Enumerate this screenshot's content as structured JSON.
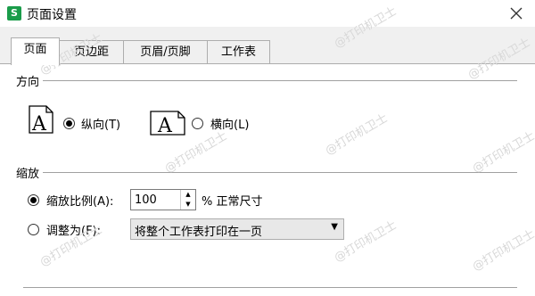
{
  "window": {
    "app_icon_letter": "S",
    "title": "页面设置"
  },
  "tabs": [
    {
      "label": "页面",
      "active": true
    },
    {
      "label": "页边距",
      "active": false
    },
    {
      "label": "页眉/页脚",
      "active": false
    },
    {
      "label": "工作表",
      "active": false
    }
  ],
  "orientation": {
    "section_label": "方向",
    "icon_letter": "A",
    "portrait_label": "纵向(T)",
    "landscape_label": "横向(L)",
    "selected": "portrait"
  },
  "scaling": {
    "section_label": "缩放",
    "scale_label": "缩放比例(A):",
    "scale_value": "100",
    "scale_suffix": "% 正常尺寸",
    "fit_label": "调整为(F):",
    "fit_option": "将整个工作表打印在一页",
    "selected": "scale"
  },
  "watermark_text": "@打印机卫士",
  "colors": {
    "app_icon": "#1a9c4a"
  }
}
